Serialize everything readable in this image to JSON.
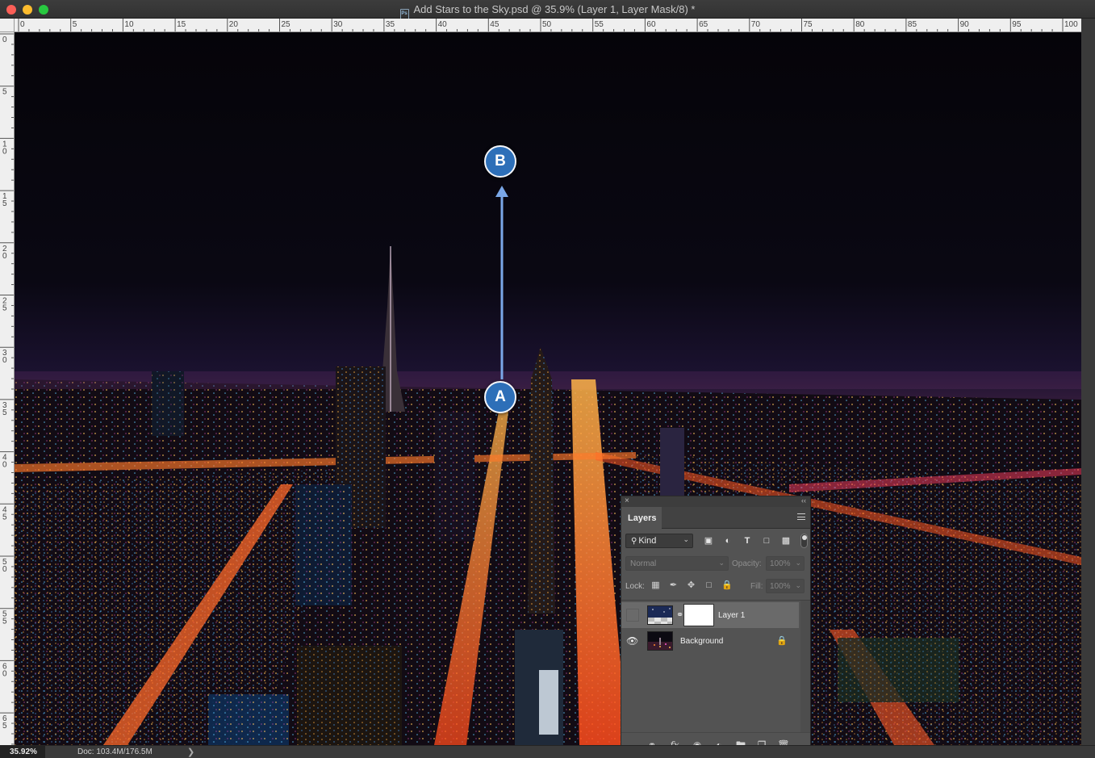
{
  "window": {
    "title": "Add Stars to the Sky.psd @ 35.9% (Layer 1, Layer Mask/8) *",
    "file_badge": "Ps"
  },
  "ruler": {
    "horizontal_labels": [
      "0",
      "5",
      "10",
      "15",
      "20",
      "25",
      "30",
      "35",
      "40",
      "45",
      "50",
      "55",
      "60",
      "65",
      "70",
      "75",
      "80",
      "85",
      "90",
      "95",
      "100"
    ],
    "vertical_labels": [
      "0",
      "5",
      "10",
      "15",
      "20",
      "25",
      "30",
      "35",
      "40",
      "45",
      "50",
      "55",
      "60",
      "65"
    ]
  },
  "annotations": {
    "marker_a": "A",
    "marker_b": "B",
    "arrow_color": "#7aa7e8",
    "marker_color": "#2d6fb8"
  },
  "status": {
    "zoom": "35.92%",
    "doc": "Doc: 103.4M/176.5M",
    "arrow": "❯"
  },
  "layers_panel": {
    "close": "×",
    "collapse": "‹‹",
    "tab": "Layers",
    "filter_kind": "Kind",
    "filter_icons": [
      "image-filter-icon",
      "adjustment-filter-icon",
      "type-filter-icon",
      "shape-filter-icon",
      "smart-object-filter-icon"
    ],
    "blend_mode": "Normal",
    "opacity_label": "Opacity:",
    "opacity_value": "100%",
    "lock_label": "Lock:",
    "fill_label": "Fill:",
    "fill_value": "100%",
    "layers": [
      {
        "name": "Layer 1",
        "visible": false,
        "selected": true,
        "has_mask": true
      },
      {
        "name": "Background",
        "visible": true,
        "selected": false,
        "locked": true
      }
    ],
    "bottom_icons": [
      "link-icon",
      "fx-icon",
      "add-mask-icon",
      "adjustment-icon",
      "group-folder-icon",
      "new-layer-icon",
      "trash-icon"
    ]
  }
}
